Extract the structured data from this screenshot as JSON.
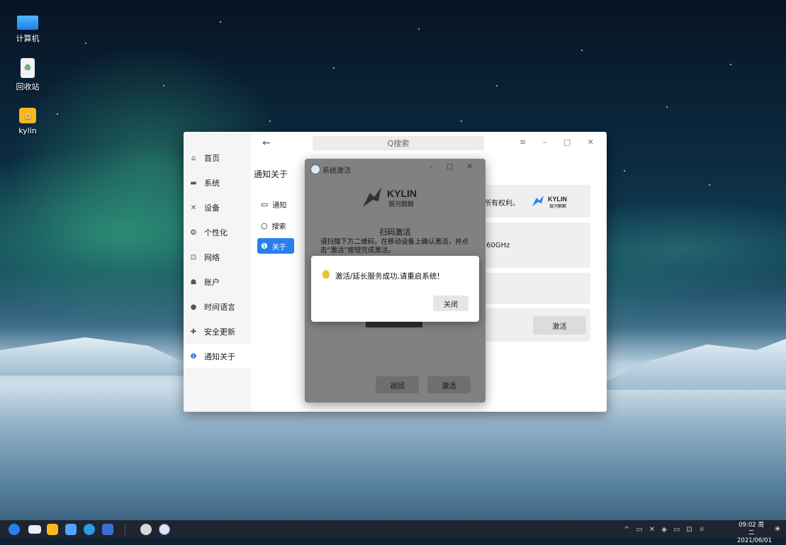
{
  "desktop": {
    "icons": [
      {
        "label": "计算机",
        "icon": "computer-icon"
      },
      {
        "label": "回收站",
        "icon": "trash-icon"
      },
      {
        "label": "kylin",
        "icon": "home-folder-icon"
      }
    ]
  },
  "settings": {
    "search_placeholder": "Q搜索",
    "back": "←",
    "window_controls": "≡ – □ ✕",
    "page_title": "通知关于",
    "nav": [
      {
        "label": "首页",
        "icon": "home-icon"
      },
      {
        "label": "系统",
        "icon": "monitor-icon"
      },
      {
        "label": "设备",
        "icon": "device-icon"
      },
      {
        "label": "个性化",
        "icon": "palette-icon"
      },
      {
        "label": "网络",
        "icon": "network-icon"
      },
      {
        "label": "账户",
        "icon": "user-icon"
      },
      {
        "label": "时间语言",
        "icon": "clock-icon"
      },
      {
        "label": "安全更新",
        "icon": "shield-icon"
      },
      {
        "label": "通知关于",
        "icon": "info-icon",
        "active": true
      }
    ],
    "sub_nav": [
      {
        "label": "通知",
        "icon": "chat-icon"
      },
      {
        "label": "搜索",
        "icon": "search-icon"
      },
      {
        "label": "关于",
        "icon": "info-icon",
        "active": true
      }
    ],
    "cards": {
      "rights_text": "所有权利。",
      "cpu_text": ".60GHz",
      "activate_button": "激活"
    }
  },
  "activation_dialog": {
    "title": "系统激活",
    "window_controls": "– □ ✕",
    "logo_text": "KYLIN",
    "logo_subtext": "银河麒麟",
    "scan_title": "扫码激活",
    "scan_description": "请扫描下方二维码，在移动设备上确认激活，并点击“激活”按钮完成激活。",
    "back_button": "返回",
    "activate_button": "激活"
  },
  "popup": {
    "message": "激活/延长服务成功,请重启系统!",
    "close_button": "关闭"
  },
  "taskbar": {
    "time": "09:02 周二",
    "date": "2021/06/01"
  },
  "colors": {
    "accent": "#2a7ff0",
    "taskbar": "#1e2530",
    "dialog": "#818181"
  }
}
